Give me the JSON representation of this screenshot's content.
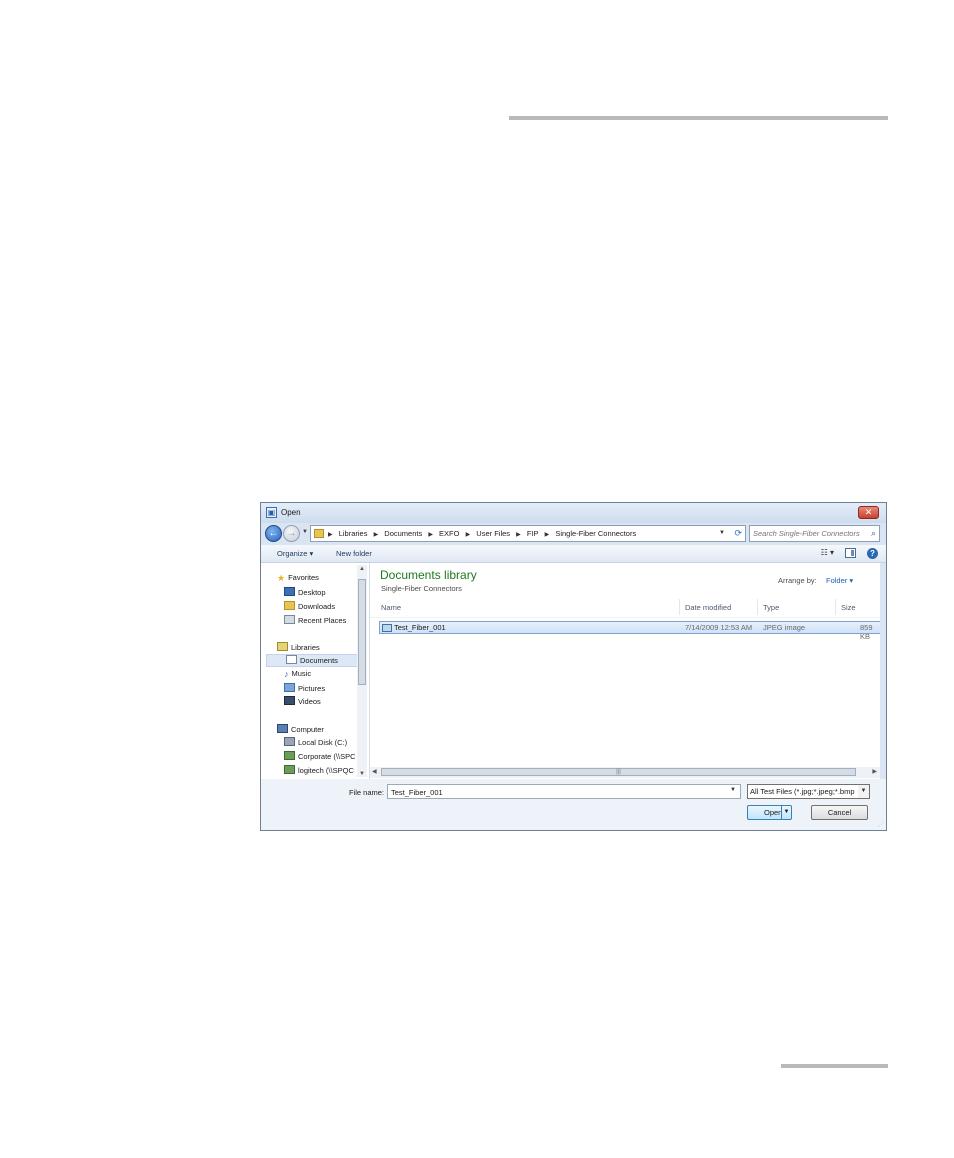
{
  "dialog": {
    "title": "Open"
  },
  "address": {
    "crumbs": [
      "Libraries",
      "Documents",
      "EXFO",
      "User Files",
      "FIP",
      "Single-Fiber Connectors"
    ],
    "search_placeholder": "Search Single-Fiber Connectors"
  },
  "toolbar": {
    "organize": "Organize ▾",
    "new_folder": "New folder"
  },
  "nav": {
    "favorites": "Favorites",
    "desktop": "Desktop",
    "downloads": "Downloads",
    "recent": "Recent Places",
    "libraries": "Libraries",
    "documents": "Documents",
    "music": "Music",
    "pictures": "Pictures",
    "videos": "Videos",
    "computer": "Computer",
    "local_disk": "Local Disk (C:)",
    "corporate": "Corporate (\\\\SPC",
    "logitech": "logitech (\\\\SPQC"
  },
  "content": {
    "library_title": "Documents library",
    "library_sub": "Single-Fiber Connectors",
    "arrange_label": "Arrange by:",
    "arrange_value": "Folder ▾",
    "columns": {
      "name": "Name",
      "date": "Date modified",
      "type": "Type",
      "size": "Size"
    },
    "files": [
      {
        "name": "Test_Fiber_001",
        "date": "7/14/2009 12:53 AM",
        "type": "JPEG image",
        "size": "859 KB"
      }
    ]
  },
  "bottom": {
    "file_name_label": "File name:",
    "file_name_value": "Test_Fiber_001",
    "filter": "All Test Files (*.jpg;*.jpeg;*.bmp",
    "open": "Open",
    "cancel": "Cancel"
  },
  "colors": {
    "accent": "#1e7a1e",
    "selection": "#cfe2f7",
    "frame": "#d9e5f3",
    "close": "#c7412f"
  }
}
